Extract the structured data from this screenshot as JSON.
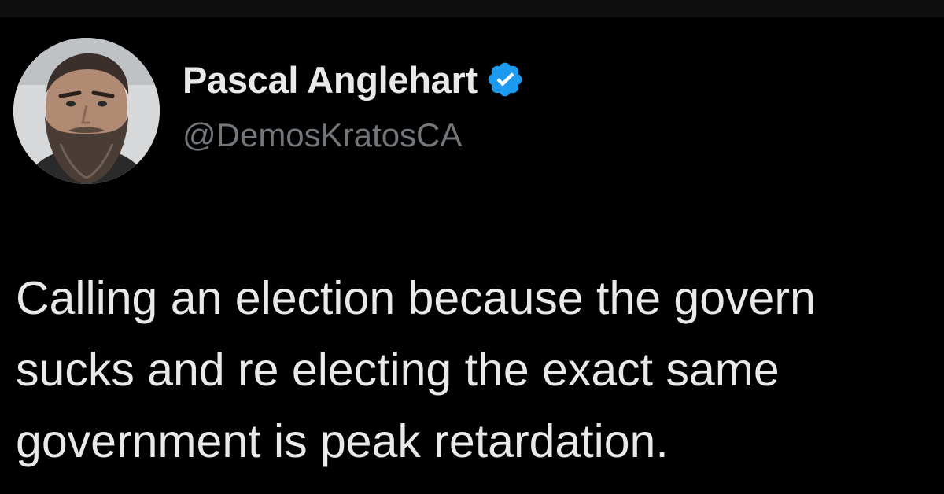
{
  "tweet": {
    "author": {
      "display_name": "Pascal Anglehart",
      "handle": "@DemosKratosCA",
      "verified_icon": "verified-badge-icon",
      "avatar": "avatar-photo"
    },
    "lines": [
      "Calling an election because the govern",
      "sucks and re electing the exact same",
      "government is peak retardation."
    ]
  },
  "colors": {
    "background": "#000000",
    "text": "#e7e9ea",
    "handle": "#71767b",
    "verified": "#1d9bf0"
  }
}
